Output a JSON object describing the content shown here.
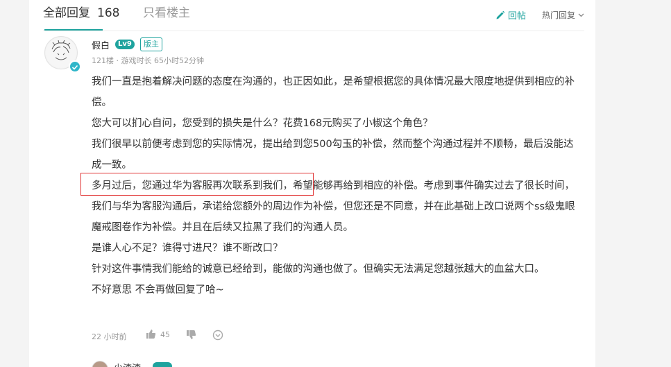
{
  "tabs": {
    "all_label": "全部回复",
    "all_count": "168",
    "owner_only_label": "只看楼主"
  },
  "actions": {
    "reply_label": "回帖",
    "sort_label": "热门回复"
  },
  "post": {
    "author": "假白",
    "level": "Lv9",
    "badge": "版主",
    "meta": "121楼 · 游戏时长 65小时52分钟",
    "paragraphs": [
      "我们一直是抱着解决问题的态度在沟通的，也正因如此，是希望根据您的具体情况最大限度地提供到相应的补偿。",
      "您大可以扪心自问，您受到的损失是什么？花费168元购买了小椒这个角色？",
      "我们很早以前便考虑到您的实际情况，提出给到您500勾玉的补偿，然而整个沟通过程并不顺畅，最后没能达成一致。",
      "多月过后，您通过华为客服再次联系到我们，希望能够再给到相应的补偿。考虑到事件确实过去了很长时间，我们与华为客服沟通后，承诺给您额外的周边作为补偿，但您还是不同意，并在此基础上改口说两个ss级鬼眼魔戒图卷作为补偿。并且在后续又拉黑了我们的沟通人员。",
      "是谁人心不足？谁得寸进尺？谁不断改口？",
      "针对这件事情我们能给的诚意已经给到，能做的沟通也做了。但确实无法满足您越张越大的血盆大口。",
      "不好意思 不会再做回复了哈~"
    ],
    "time": "22 小时前",
    "likes": "45"
  },
  "next_post": {
    "author": "少渣渣"
  },
  "colors": {
    "accent": "#1ea39e",
    "highlight_border": "#e03232",
    "muted": "#999999"
  },
  "icons": [
    "pencil-icon",
    "chevron-down-icon",
    "thumbs-up-icon",
    "thumbs-down-icon",
    "more-options-icon",
    "verified-icon"
  ]
}
